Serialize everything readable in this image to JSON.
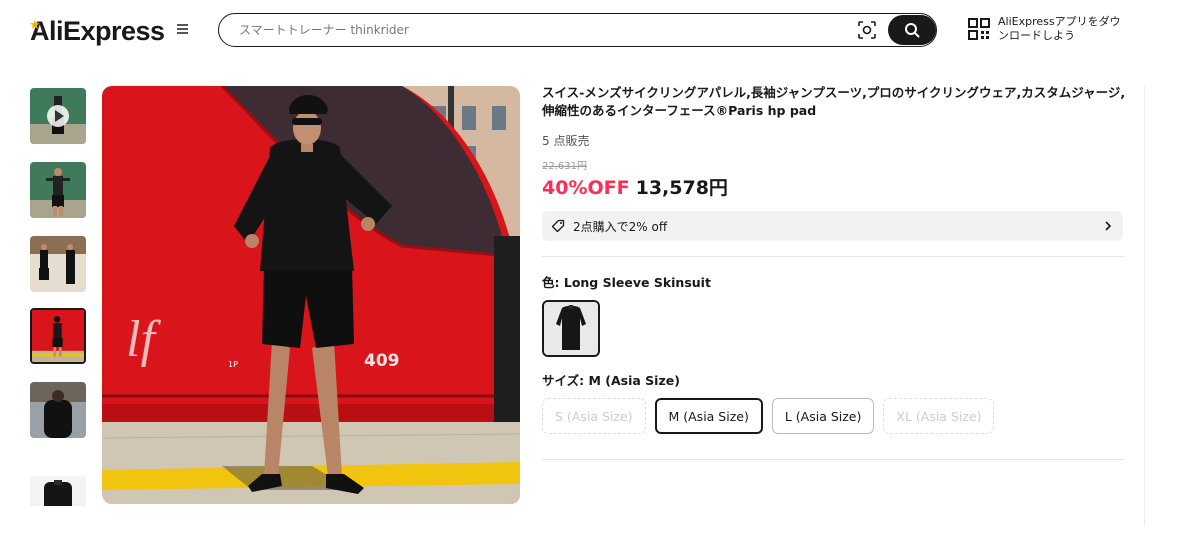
{
  "header": {
    "logo_text": "AliExpress",
    "search_placeholder": "スマートトレーナー thinkrider",
    "app_download_label": "AliExpressアプリをダウンロードしよう"
  },
  "gallery": {
    "thumbnails": [
      {
        "name": "thumb-video",
        "has_play": true
      },
      {
        "name": "thumb-2"
      },
      {
        "name": "thumb-3"
      },
      {
        "name": "thumb-4",
        "active": true
      },
      {
        "name": "thumb-5"
      },
      {
        "name": "thumb-6"
      }
    ],
    "main_image_number": "409",
    "main_image_car_label": "1P"
  },
  "product": {
    "title": "スイス-メンズサイクリングアパレル,長袖ジャンプスーツ,プロのサイクリングウェア,カスタムジャージ,伸縮性のあるインターフェース®Paris hp pad",
    "sold": "5 点販売",
    "original_price": "22,631円",
    "discount": "40%OFF",
    "price": "13,578円",
    "promo": "2点購入で2% off",
    "color_label": "色: Long Sleeve Skinsuit",
    "size_label": "サイズ: M (Asia Size)",
    "sizes": [
      {
        "label": "S (Asia Size)",
        "state": "disabled"
      },
      {
        "label": "M (Asia Size)",
        "state": "selected"
      },
      {
        "label": "L (Asia Size)",
        "state": "available"
      },
      {
        "label": "XL (Asia Size)",
        "state": "disabled"
      }
    ]
  },
  "colors": {
    "accent_red": "#ff2d55",
    "text": "#191919",
    "train_red": "#d9141b"
  }
}
